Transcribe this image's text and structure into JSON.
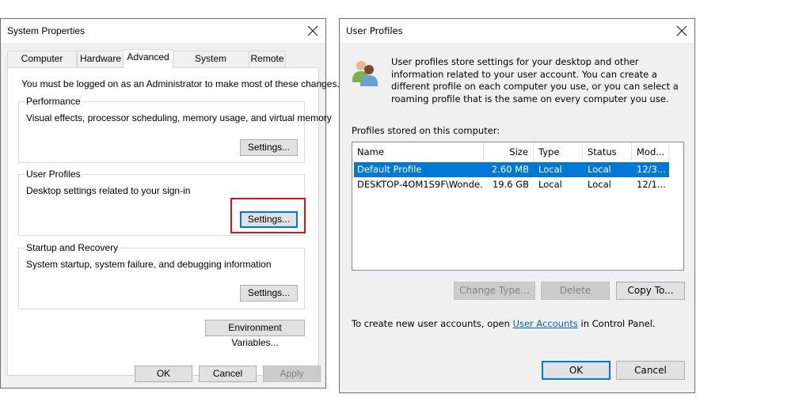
{
  "system_properties": {
    "title": "System Properties",
    "tabs": [
      {
        "label": "Computer Name",
        "active": false
      },
      {
        "label": "Hardware",
        "active": false
      },
      {
        "label": "Advanced",
        "active": true
      },
      {
        "label": "System Protection",
        "active": false
      },
      {
        "label": "Remote",
        "active": false
      }
    ],
    "admin_notice": "You must be logged on as an Administrator to make most of these changes.",
    "groups": {
      "performance": {
        "label": "Performance",
        "description": "Visual effects, processor scheduling, memory usage, and virtual memory",
        "button": "Settings..."
      },
      "user_profiles": {
        "label": "User Profiles",
        "description": "Desktop settings related to your sign-in",
        "button": "Settings..."
      },
      "startup_recovery": {
        "label": "Startup and Recovery",
        "description": "System startup, system failure, and debugging information",
        "button": "Settings..."
      }
    },
    "env_vars_button": "Environment Variables...",
    "ok_button": "OK",
    "cancel_button": "Cancel",
    "apply_button": "Apply"
  },
  "user_profiles": {
    "title": "User Profiles",
    "intro": "User profiles store settings for your desktop and other information related to your user account. You can create a different profile on each computer you use, or you can select a roaming profile that is the same on every computer you use.",
    "profiles_label": "Profiles stored on this computer:",
    "columns": [
      "Name",
      "Size",
      "Type",
      "Status",
      "Mod..."
    ],
    "rows": [
      {
        "name": "Default Profile",
        "size": "2.60 MB",
        "type": "Local",
        "status": "Local",
        "modified": "12/3...",
        "selected": true
      },
      {
        "name": "DESKTOP-4OM1S9F\\Wonde...",
        "size": "19.6 GB",
        "type": "Local",
        "status": "Local",
        "modified": "12/1...",
        "selected": false
      }
    ],
    "change_type_button": "Change Type...",
    "delete_button": "Delete",
    "copy_to_button": "Copy To...",
    "footer_prefix": "To create new user accounts, open ",
    "footer_link": "User Accounts",
    "footer_suffix": " in Control Panel.",
    "ok_button": "OK",
    "cancel_button": "Cancel"
  },
  "colors": {
    "selection": "#0078d7",
    "highlight_box": "#d9141b",
    "link": "#0066cc"
  }
}
